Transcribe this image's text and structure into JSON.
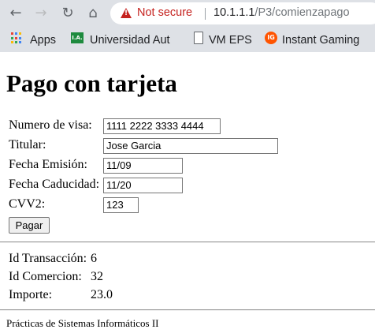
{
  "browser": {
    "security_label": "Not secure",
    "url_host": "10.1.1.1",
    "url_path": "/P3/comienzapago",
    "bookmarks": [
      {
        "label": "Apps",
        "icon": "apps-grid-icon"
      },
      {
        "label": "Universidad Aut",
        "icon": "ua-icon"
      },
      {
        "label": "VM EPS",
        "icon": "document-icon"
      },
      {
        "label": "Instant Gaming",
        "icon": "instant-gaming-icon"
      }
    ]
  },
  "page": {
    "title": "Pago con tarjeta",
    "form": {
      "visa_label": "Numero de visa:",
      "visa_value": "1111 2222 3333 4444",
      "holder_label": "Titular:",
      "holder_value": "Jose Garcia",
      "issue_label": "Fecha Emisión:",
      "issue_value": "11/09",
      "expiry_label": "Fecha Caducidad:",
      "expiry_value": "11/20",
      "cvv_label": "CVV2:",
      "cvv_value": "123",
      "submit_label": "Pagar"
    },
    "transaction": {
      "id_label": "Id Transacción:",
      "id_value": "6",
      "merchant_label": "Id Comercion:",
      "merchant_value": "32",
      "amount_label": "Importe:",
      "amount_value": "23.0"
    },
    "footer": "Prácticas de Sistemas Informáticos II"
  },
  "colors": {
    "chrome_bg": "#dee1e6",
    "warning_red": "#c5221f"
  }
}
